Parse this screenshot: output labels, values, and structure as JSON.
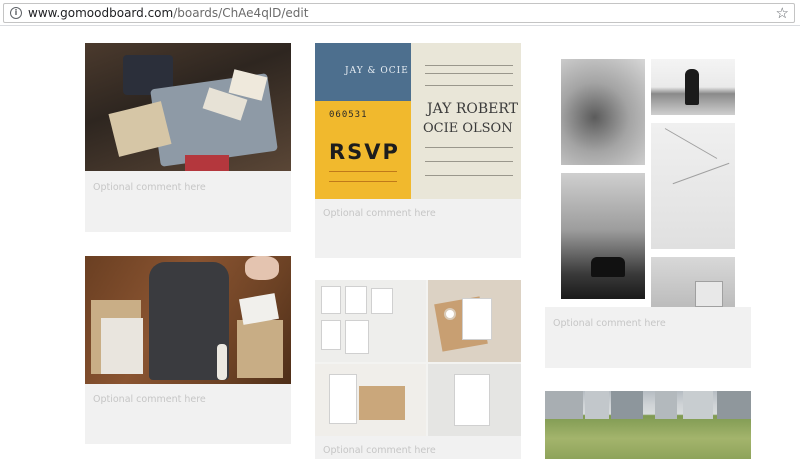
{
  "browser": {
    "url_domain": "www.gomoodboard.com",
    "url_path": "/boards/ChAe4qlD/edit",
    "info_icon": "info-icon",
    "bookmark_icon": "star-icon"
  },
  "board": {
    "cards": [
      {
        "name": "card-clothes",
        "image": "folded-clothes-photo",
        "comment_placeholder": "Optional comment here"
      },
      {
        "name": "card-wedding-invite",
        "image": "wedding-invitation-photo",
        "comment_placeholder": "Optional comment here",
        "invite_text": {
          "monogram": "JAY & OCIE",
          "number": "060531",
          "rsvp": "RSVP",
          "names_line1": "JAY ROBERT",
          "names_line2": "OCIE OLSON"
        }
      },
      {
        "name": "card-bw-collage",
        "image": "black-white-photo-collage",
        "comment_placeholder": "Optional comment here"
      },
      {
        "name": "card-hoodie",
        "image": "hoodie-flatlay-photo",
        "comment_placeholder": "Optional comment here"
      },
      {
        "name": "card-merchant",
        "image": "merchant-stationery-photo",
        "comment_placeholder": "Optional comment here"
      },
      {
        "name": "card-field",
        "image": "green-field-photo"
      }
    ]
  }
}
